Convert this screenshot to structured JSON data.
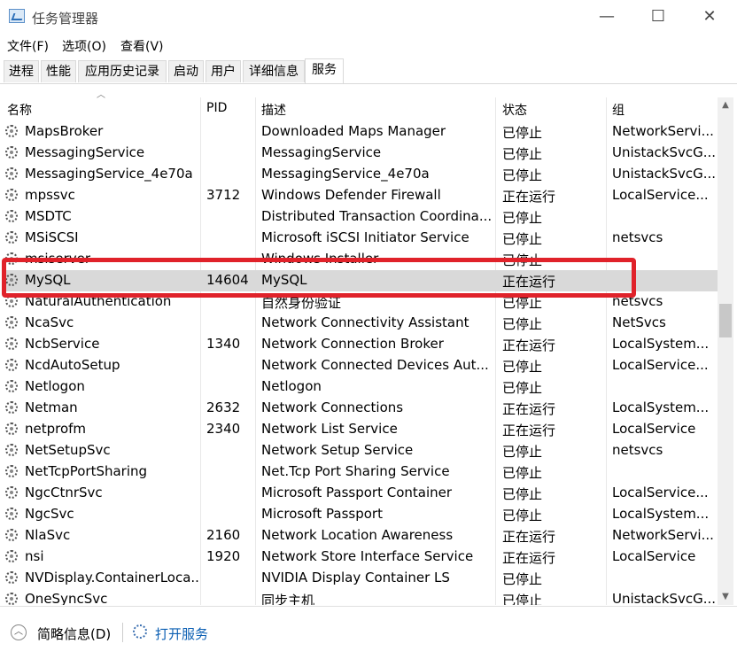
{
  "window": {
    "title": "任务管理器",
    "minimize": "—",
    "maximize": "☐",
    "close": "✕"
  },
  "menu": [
    "文件(F)",
    "选项(O)",
    "查看(V)"
  ],
  "tabs": [
    "进程",
    "性能",
    "应用历史记录",
    "启动",
    "用户",
    "详细信息",
    "服务"
  ],
  "active_tab": "服务",
  "columns": [
    "名称",
    "PID",
    "描述",
    "状态",
    "组"
  ],
  "rows": [
    {
      "name": "MapsBroker",
      "pid": "",
      "desc": "Downloaded Maps Manager",
      "status": "已停止",
      "group": "NetworkServi..."
    },
    {
      "name": "MessagingService",
      "pid": "",
      "desc": "MessagingService",
      "status": "已停止",
      "group": "UnistackSvcG..."
    },
    {
      "name": "MessagingService_4e70a",
      "pid": "",
      "desc": "MessagingService_4e70a",
      "status": "已停止",
      "group": "UnistackSvcG..."
    },
    {
      "name": "mpssvc",
      "pid": "3712",
      "desc": "Windows Defender Firewall",
      "status": "正在运行",
      "group": "LocalService..."
    },
    {
      "name": "MSDTC",
      "pid": "",
      "desc": "Distributed Transaction Coordina...",
      "status": "已停止",
      "group": ""
    },
    {
      "name": "MSiSCSI",
      "pid": "",
      "desc": "Microsoft iSCSI Initiator Service",
      "status": "已停止",
      "group": "netsvcs"
    },
    {
      "name": "msiserver",
      "pid": "",
      "desc": "Windows Installer",
      "status": "已停止",
      "group": ""
    },
    {
      "name": "MySQL",
      "pid": "14604",
      "desc": "MySQL",
      "status": "正在运行",
      "group": ""
    },
    {
      "name": "NaturalAuthentication",
      "pid": "",
      "desc": "自然身份验证",
      "status": "已停止",
      "group": "netsvcs"
    },
    {
      "name": "NcaSvc",
      "pid": "",
      "desc": "Network Connectivity Assistant",
      "status": "已停止",
      "group": "NetSvcs"
    },
    {
      "name": "NcbService",
      "pid": "1340",
      "desc": "Network Connection Broker",
      "status": "正在运行",
      "group": "LocalSystem..."
    },
    {
      "name": "NcdAutoSetup",
      "pid": "",
      "desc": "Network Connected Devices Aut...",
      "status": "已停止",
      "group": "LocalService..."
    },
    {
      "name": "Netlogon",
      "pid": "",
      "desc": "Netlogon",
      "status": "已停止",
      "group": ""
    },
    {
      "name": "Netman",
      "pid": "2632",
      "desc": "Network Connections",
      "status": "正在运行",
      "group": "LocalSystem..."
    },
    {
      "name": "netprofm",
      "pid": "2340",
      "desc": "Network List Service",
      "status": "正在运行",
      "group": "LocalService"
    },
    {
      "name": "NetSetupSvc",
      "pid": "",
      "desc": "Network Setup Service",
      "status": "已停止",
      "group": "netsvcs"
    },
    {
      "name": "NetTcpPortSharing",
      "pid": "",
      "desc": "Net.Tcp Port Sharing Service",
      "status": "已停止",
      "group": ""
    },
    {
      "name": "NgcCtnrSvc",
      "pid": "",
      "desc": "Microsoft Passport Container",
      "status": "已停止",
      "group": "LocalService..."
    },
    {
      "name": "NgcSvc",
      "pid": "",
      "desc": "Microsoft Passport",
      "status": "已停止",
      "group": "LocalSystem..."
    },
    {
      "name": "NlaSvc",
      "pid": "2160",
      "desc": "Network Location Awareness",
      "status": "正在运行",
      "group": "NetworkServi..."
    },
    {
      "name": "nsi",
      "pid": "1920",
      "desc": "Network Store Interface Service",
      "status": "正在运行",
      "group": "LocalService"
    },
    {
      "name": "NVDisplay.ContainerLoca...",
      "pid": "",
      "desc": "NVIDIA Display Container LS",
      "status": "已停止",
      "group": ""
    },
    {
      "name": "OneSyncSvc",
      "pid": "",
      "desc": "同步主机",
      "status": "已停止",
      "group": "UnistackSvcG..."
    }
  ],
  "selected_row": "MySQL",
  "footer": {
    "fewer_details": "简略信息(D)",
    "open_services": "打开服务"
  },
  "colors": {
    "highlight": "#e0222a",
    "selection": "#d9d9d9",
    "link": "#0b5fb3"
  }
}
